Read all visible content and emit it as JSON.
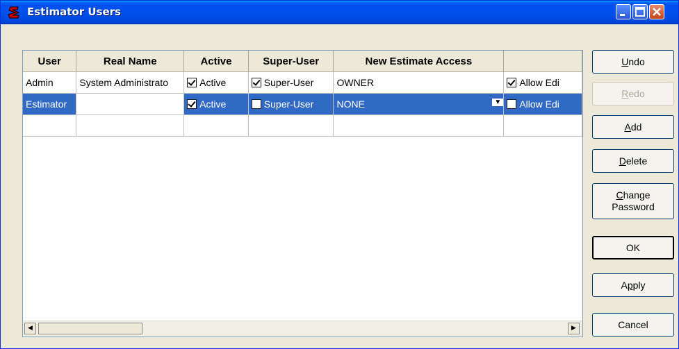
{
  "window": {
    "title": "Estimator Users",
    "icon": "s-logo-icon",
    "accent": "#0054e3"
  },
  "table": {
    "columns": [
      "User",
      "Real Name",
      "Active",
      "Super-User",
      "New Estimate Access",
      ""
    ],
    "rows": [
      {
        "user": "Admin",
        "real_name": "System Administrato",
        "active": true,
        "active_label": "Active",
        "super": true,
        "super_label": "Super-User",
        "access": "OWNER",
        "allow": true,
        "allow_label": "Allow Edi"
      },
      {
        "user": "Estimator",
        "real_name": "",
        "active": true,
        "active_label": "Active",
        "super": false,
        "super_label": "Super-User",
        "access": "NONE",
        "allow": false,
        "allow_label": "Allow Edi"
      }
    ]
  },
  "buttons": {
    "undo": {
      "hot": "U",
      "rest": "ndo"
    },
    "redo": {
      "hot": "R",
      "rest": "edo"
    },
    "add": {
      "hot": "A",
      "rest": "dd"
    },
    "delete": {
      "hot": "D",
      "rest": "elete"
    },
    "change_password": {
      "hot": "C",
      "rest": "hange",
      "line2": "Password"
    },
    "ok": {
      "label": "OK"
    },
    "apply": {
      "pre": "A",
      "hot": "p",
      "rest": "ply"
    },
    "cancel": {
      "label": "Cancel"
    }
  },
  "colors": {
    "selection": "#316ac5",
    "face": "#ece9d8"
  }
}
